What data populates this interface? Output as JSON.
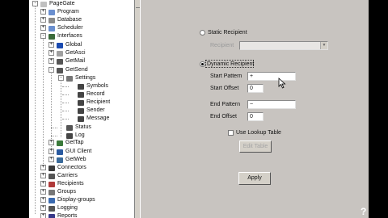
{
  "tree": {
    "items": [
      {
        "label": "PageGate",
        "color": "#c0c0c0",
        "exp": "-"
      },
      {
        "label": "Program",
        "color": "#6a8fcf",
        "exp": "+"
      },
      {
        "label": "Database",
        "color": "#8a8a8a",
        "exp": "+"
      },
      {
        "label": "Scheduler",
        "color": "#6a8fcf",
        "exp": "+"
      },
      {
        "label": "Interfaces",
        "color": "#3a6a3a",
        "exp": "-"
      },
      {
        "label": "Global",
        "color": "#1a4ab0",
        "exp": "+"
      },
      {
        "label": "GetAsci",
        "color": "#a0a0a0",
        "exp": "+"
      },
      {
        "label": "GetMail",
        "color": "#555555",
        "exp": "+"
      },
      {
        "label": "GetSend",
        "color": "#555555",
        "exp": "-"
      },
      {
        "label": "Settings",
        "color": "#777777",
        "exp": "-"
      },
      {
        "label": "Symbols",
        "color": "#444444",
        "exp": ""
      },
      {
        "label": "Record",
        "color": "#444444",
        "exp": ""
      },
      {
        "label": "Recipient",
        "color": "#444444",
        "exp": ""
      },
      {
        "label": "Sender",
        "color": "#444444",
        "exp": ""
      },
      {
        "label": "Message",
        "color": "#444444",
        "exp": ""
      },
      {
        "label": "Status",
        "color": "#555555",
        "exp": ""
      },
      {
        "label": "Log",
        "color": "#444444",
        "exp": ""
      },
      {
        "label": "GetTap",
        "color": "#3a7a3a",
        "exp": "+"
      },
      {
        "label": "GUI Client",
        "color": "#2a5aa0",
        "exp": "+"
      },
      {
        "label": "GetWeb",
        "color": "#3a6a9a",
        "exp": "+"
      },
      {
        "label": "Connectors",
        "color": "#3a3a3a",
        "exp": "+"
      },
      {
        "label": "Carriers",
        "color": "#555555",
        "exp": "+"
      },
      {
        "label": "Recipients",
        "color": "#b03a3a",
        "exp": "+"
      },
      {
        "label": "Groups",
        "color": "#777777",
        "exp": "+"
      },
      {
        "label": "Display-groups",
        "color": "#3a6ab0",
        "exp": "+"
      },
      {
        "label": "Logging",
        "color": "#555555",
        "exp": "+"
      },
      {
        "label": "Reports",
        "color": "#3a3a8a",
        "exp": "+"
      }
    ]
  },
  "form": {
    "static_recipient_label": "Static Recipient",
    "recipient_field_label": "Recipient",
    "recipient_value": "",
    "dynamic_recipient_label": "Dynamic Recipient",
    "start_pattern_label": "Start Pattern",
    "start_pattern_value": "+",
    "start_offset_label": "Start Offset",
    "start_offset_value": "0",
    "end_pattern_label": "End Pattern",
    "end_pattern_value": "~",
    "end_offset_label": "End Offset",
    "end_offset_value": "0",
    "use_lookup_label": "Use Lookup Table",
    "edit_table_label": "Edit Table",
    "apply_label": "Apply"
  },
  "right_glyph": "?"
}
